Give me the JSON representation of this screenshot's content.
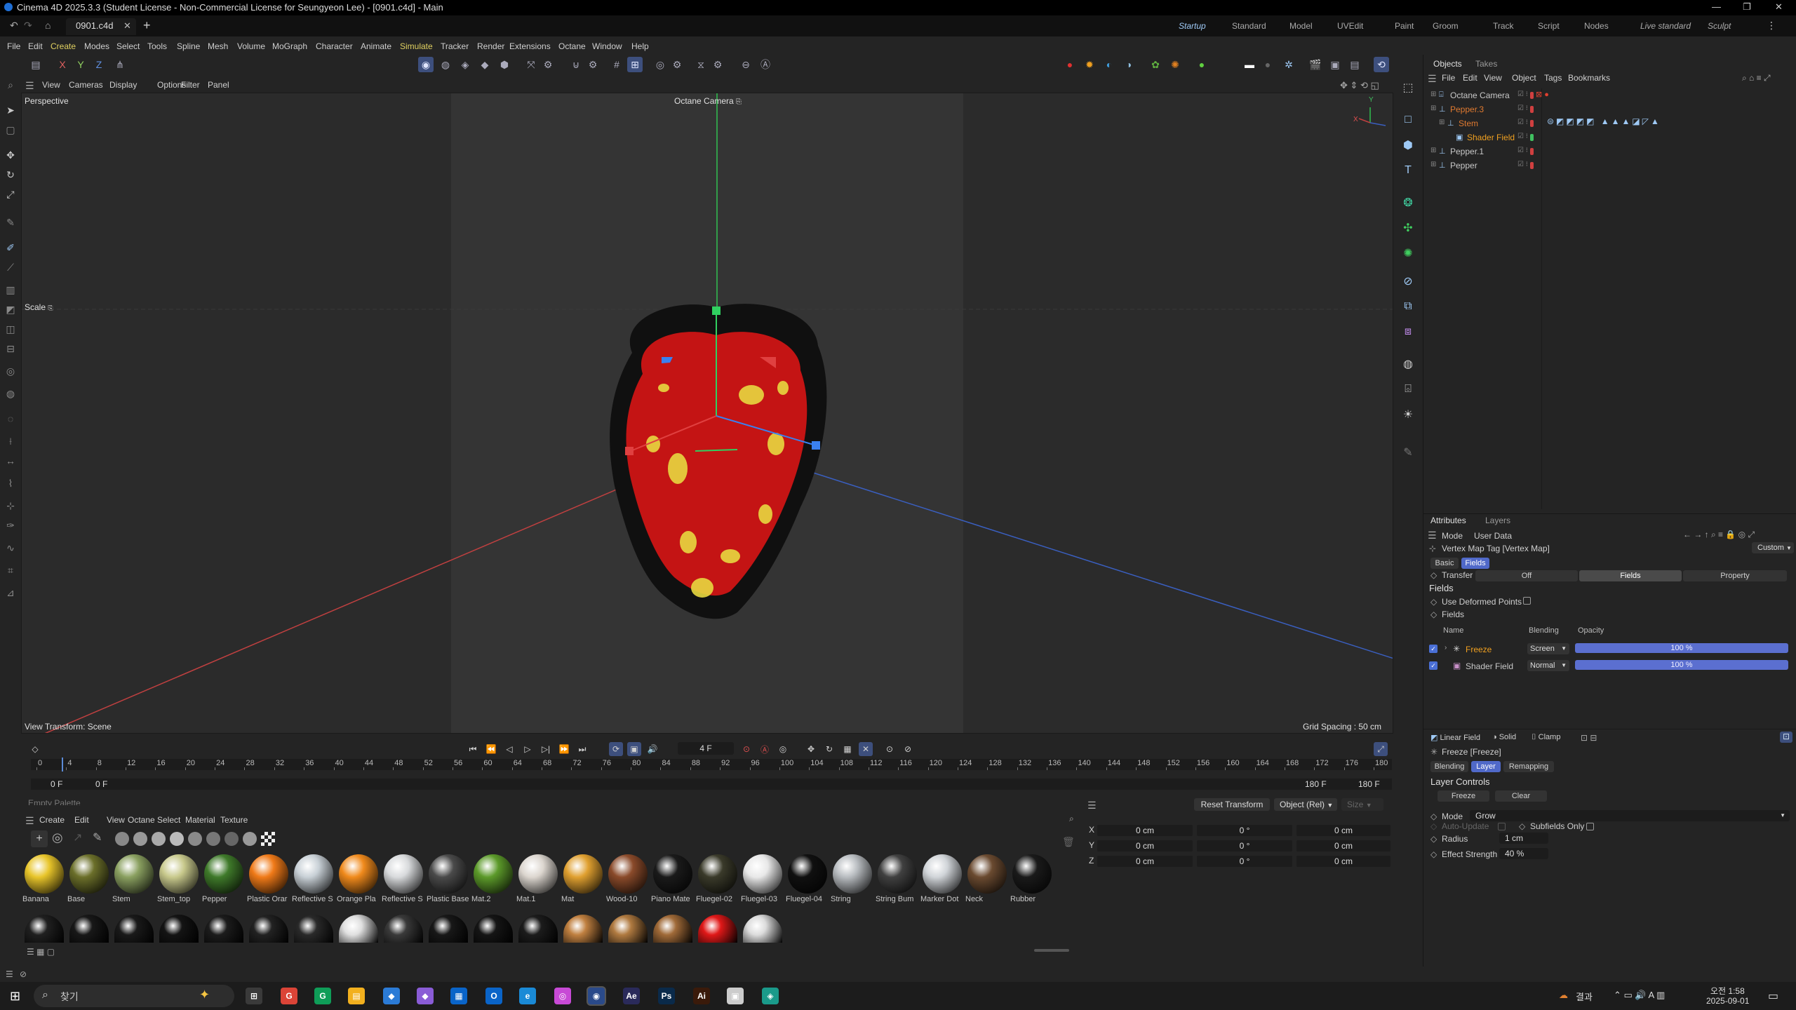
{
  "app": {
    "window_title": "Cinema 4D 2025.3.3 (Student License - Non-Commercial License for Seungyeon Lee) - [0901.c4d] - Main",
    "document_tab": "0901.c4d"
  },
  "layouts": [
    "Startup",
    "Standard",
    "Model",
    "UVEdit",
    "Paint",
    "Groom",
    "Track",
    "Script",
    "Nodes",
    "Live standard",
    "Sculpt"
  ],
  "menu": [
    "File",
    "Edit",
    "Create",
    "Modes",
    "Select",
    "Tools",
    "Spline",
    "Mesh",
    "Volume",
    "MoGraph",
    "Character",
    "Animate",
    "Simulate",
    "Tracker",
    "Render",
    "Extensions",
    "Octane",
    "Window",
    "Help"
  ],
  "axes_toolbar": [
    "X",
    "Y",
    "Z"
  ],
  "viewport": {
    "menu": [
      "View",
      "Cameras",
      "Display",
      "Options",
      "Filter",
      "Panel"
    ],
    "mode": "Perspective",
    "camera": "Octane Camera",
    "scale_label": "Scale",
    "view_transform": "View Transform: Scene",
    "grid_spacing": "Grid Spacing : 50 cm",
    "axis_y": "Y",
    "axis_x": "X",
    "axis_z": "Z"
  },
  "timeline": {
    "current_frame": "4 F",
    "start_field": "0 F",
    "start_field2": "0 F",
    "end_field": "180 F",
    "end_field2": "180 F",
    "ticks": [
      "0",
      "4",
      "8",
      "12",
      "16",
      "20",
      "24",
      "28",
      "32",
      "36",
      "40",
      "44",
      "48",
      "52",
      "56",
      "60",
      "64",
      "68",
      "72",
      "76",
      "80",
      "84",
      "88",
      "92",
      "96",
      "100",
      "104",
      "108",
      "112",
      "116",
      "120",
      "124",
      "128",
      "132",
      "136",
      "140",
      "144",
      "148",
      "152",
      "156",
      "160",
      "164",
      "168",
      "172",
      "176",
      "180"
    ]
  },
  "material_manager": {
    "palette_label": "Empty Palette",
    "menu": [
      "Create",
      "Edit",
      "View",
      "Octane",
      "Select",
      "Material",
      "Texture"
    ],
    "row1": [
      {
        "name": "Banana",
        "color": "#e8c52a"
      },
      {
        "name": "Base",
        "color": "#6b6f2a"
      },
      {
        "name": "Stem",
        "color": "#8aa060"
      },
      {
        "name": "Stem_top",
        "color": "#c8c98c"
      },
      {
        "name": "Pepper",
        "color": "#3f7a2a"
      },
      {
        "name": "Plastic Orar",
        "color": "#f07a18"
      },
      {
        "name": "Reflective S",
        "color": "#c8d0d6"
      },
      {
        "name": "Orange Pla",
        "color": "#f08a1c"
      },
      {
        "name": "Reflective S",
        "color": "#d8dadc"
      },
      {
        "name": "Plastic Base",
        "color": "#4a4a4a"
      },
      {
        "name": "Mat.2",
        "color": "#5c9a2a"
      },
      {
        "name": "Mat.1",
        "color": "#dcd6cf"
      },
      {
        "name": "Mat",
        "color": "#e0a030"
      },
      {
        "name": "Wood-10",
        "color": "#8a4a2a"
      },
      {
        "name": "Piano Mate",
        "color": "#1a1a1a"
      },
      {
        "name": "Fluegel-02",
        "color": "#3a3a2a"
      },
      {
        "name": "Fluegel-03",
        "color": "#e8e8e8"
      },
      {
        "name": "Fluegel-04",
        "color": "#101010"
      },
      {
        "name": "String",
        "color": "#b8bcc0"
      },
      {
        "name": "String Bum",
        "color": "#404040"
      },
      {
        "name": "Marker Dot",
        "color": "#d0d4d8"
      },
      {
        "name": "Neck",
        "color": "#6a4a30"
      },
      {
        "name": "Rubber",
        "color": "#1a1a1a"
      }
    ],
    "row2": [
      "#202020",
      "#181818",
      "#1a1a1a",
      "#141414",
      "#1c1c1c",
      "#222222",
      "#2a2a2a",
      "#e0e0e0",
      "#3a3a3a",
      "#181818",
      "#151515",
      "#1c1c1c",
      "#c08040",
      "#b07a40",
      "#a06a38",
      "#e01818",
      "#dcdcdc"
    ]
  },
  "coords": {
    "reset_button": "Reset Transform",
    "mode_select": "Object (Rel)",
    "size_select": "Size",
    "rows": [
      {
        "axis": "X",
        "pos": "0 cm",
        "rot": "0 °",
        "size": "0 cm"
      },
      {
        "axis": "Y",
        "pos": "0 cm",
        "rot": "0 °",
        "size": "0 cm"
      },
      {
        "axis": "Z",
        "pos": "0 cm",
        "rot": "0 °",
        "size": "0 cm"
      }
    ]
  },
  "objects_panel": {
    "tabs": [
      "Objects",
      "Takes"
    ],
    "menu": [
      "File",
      "Edit",
      "View",
      "Object",
      "Tags",
      "Bookmarks"
    ],
    "items": [
      {
        "name": "Octane Camera",
        "color": "#c8c8c8",
        "indent": 0
      },
      {
        "name": "Pepper.3",
        "color": "#e07a30",
        "indent": 0
      },
      {
        "name": "Stem",
        "color": "#e07a30",
        "indent": 1
      },
      {
        "name": "Shader Field",
        "color": "#f0a020",
        "indent": 2
      },
      {
        "name": "Pepper.1",
        "color": "#c8c8c8",
        "indent": 0
      },
      {
        "name": "Pepper",
        "color": "#c8c8c8",
        "indent": 0
      }
    ]
  },
  "attributes_panel": {
    "tabs": [
      "Attributes",
      "Layers"
    ],
    "menu": [
      "Mode",
      "User Data"
    ],
    "object_title": "Vertex Map Tag [Vertex Map]",
    "preset": "Custom",
    "subtabs": [
      "Basic",
      "Fields"
    ],
    "transfer_label": "Transfer",
    "transfer_options": [
      "Off",
      "Fields",
      "Property"
    ],
    "fields_heading": "Fields",
    "use_deformed": "Use Deformed Points",
    "fields_label": "Fields",
    "list_headers": [
      "Name",
      "Blending",
      "Opacity"
    ],
    "field_rows": [
      {
        "name": "Freeze",
        "blending": "Screen",
        "opacity": "100 %",
        "color": "#f0a020"
      },
      {
        "name": "Shader Field",
        "blending": "Normal",
        "opacity": "100 %",
        "color": "#c8c8c8"
      }
    ],
    "add_buttons": [
      "Linear Field",
      "Solid",
      "Clamp"
    ],
    "layer_title": "Freeze [Freeze]",
    "layer_tabs": [
      "Blending",
      "Layer",
      "Remapping"
    ],
    "layer_controls": "Layer Controls",
    "freeze_button": "Freeze",
    "clear_button": "Clear",
    "mode_label": "Mode",
    "mode_value": "Grow",
    "auto_update": "Auto-Update",
    "subfields_only": "Subfields Only",
    "radius_label": "Radius",
    "radius_value": "1 cm",
    "effect_label": "Effect Strength",
    "effect_value": "40 %"
  },
  "taskbar": {
    "search_placeholder": "찾기",
    "tray_text": "결과",
    "time": "오전 1:58",
    "date": "2025-09-01",
    "apps": [
      {
        "label": "⊞",
        "color": "#3a3a3a"
      },
      {
        "label": "G",
        "color": "#db4437"
      },
      {
        "label": "G",
        "color": "#0f9d58"
      },
      {
        "label": "▤",
        "color": "#f2b01e"
      },
      {
        "label": "◆",
        "color": "#2b7bd6"
      },
      {
        "label": "◆",
        "color": "#8a5cd6"
      },
      {
        "label": "▦",
        "color": "#0a64c8"
      },
      {
        "label": "O",
        "color": "#0a64c8"
      },
      {
        "label": "e",
        "color": "#1a8ad6"
      },
      {
        "label": "◎",
        "color": "#c84ad6"
      },
      {
        "label": "◉",
        "color": "#2a4a8a"
      },
      {
        "label": "Ae",
        "color": "#2a2a5a"
      },
      {
        "label": "Ps",
        "color": "#0a2a4a"
      },
      {
        "label": "Ai",
        "color": "#3a1a0a"
      },
      {
        "label": "▣",
        "color": "#cccccc"
      },
      {
        "label": "◈",
        "color": "#1a9a8a"
      }
    ]
  }
}
